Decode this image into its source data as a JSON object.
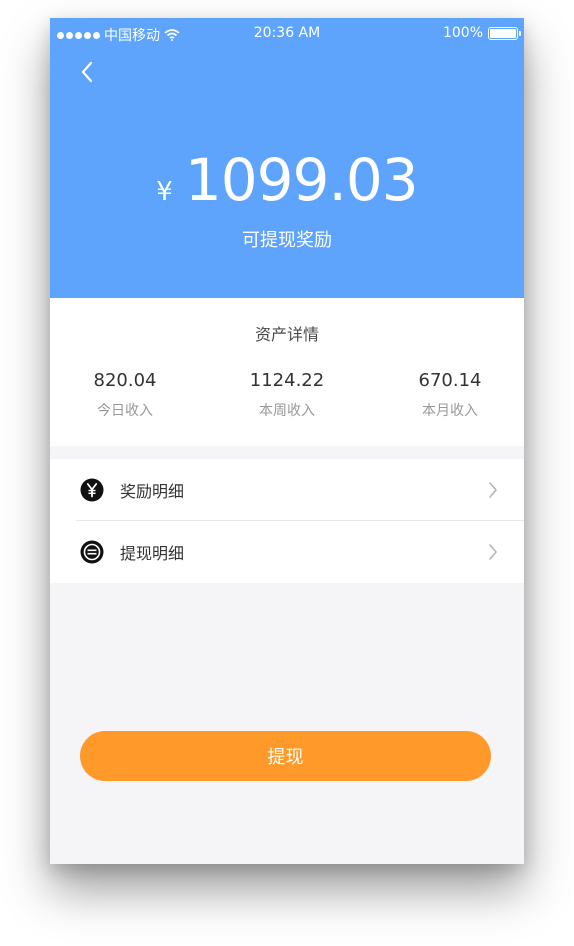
{
  "status_bar": {
    "carrier": "中国移动",
    "time": "20:36 AM",
    "battery": "100%"
  },
  "header": {
    "currency_symbol": "¥",
    "amount": "1099.03",
    "amount_label": "可提现奖励"
  },
  "assets": {
    "title": "资产详情",
    "stats": [
      {
        "value": "820.04",
        "label": "今日收入"
      },
      {
        "value": "1124.22",
        "label": "本周收入"
      },
      {
        "value": "670.14",
        "label": "本月收入"
      }
    ]
  },
  "list": {
    "items": [
      {
        "label": "奖励明细",
        "icon": "yen-icon"
      },
      {
        "label": "提现明细",
        "icon": "withdraw-record-icon"
      }
    ]
  },
  "actions": {
    "withdraw_label": "提现"
  },
  "colors": {
    "header_blue": "#5fa4fc",
    "button_orange": "#fe992a",
    "background": "#f5f4f7"
  }
}
